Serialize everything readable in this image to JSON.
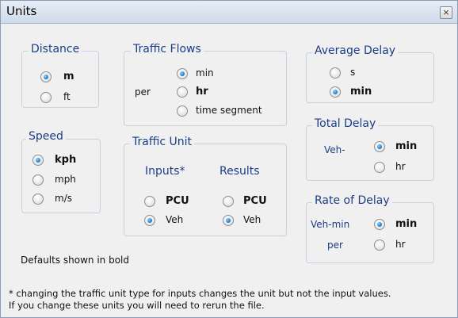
{
  "window": {
    "title": "Units",
    "close_glyph": "×"
  },
  "distance": {
    "label": "Distance",
    "options": [
      "m",
      "ft"
    ],
    "selected": "m"
  },
  "speed": {
    "label": "Speed",
    "options": [
      "kph",
      "mph",
      "m/s"
    ],
    "selected": "kph"
  },
  "traffic_flows": {
    "label": "Traffic Flows",
    "per_label": "per",
    "options": [
      "min",
      "hr",
      "time segment"
    ],
    "selected": "min"
  },
  "traffic_unit": {
    "label": "Traffic Unit",
    "inputs_label": "Inputs*",
    "results_label": "Results",
    "inputs_options": [
      "PCU",
      "Veh"
    ],
    "results_options": [
      "PCU",
      "Veh"
    ],
    "inputs_selected": "Veh",
    "results_selected": "Veh"
  },
  "average_delay": {
    "label": "Average Delay",
    "options": [
      "s",
      "min"
    ],
    "selected": "min"
  },
  "total_delay": {
    "label": "Total Delay",
    "prefix": "Veh-",
    "options": [
      "min",
      "hr"
    ],
    "selected": "min"
  },
  "rate_of_delay": {
    "label": "Rate of Delay",
    "prefix": "Veh-min",
    "per_label": "per",
    "options": [
      "min",
      "hr"
    ],
    "selected": "min"
  },
  "notes": {
    "defaults": "Defaults shown in bold",
    "footnote_1": "* changing the traffic unit type for inputs changes the unit but not the input values.",
    "footnote_2": "If you change these units you will need to rerun the file."
  }
}
